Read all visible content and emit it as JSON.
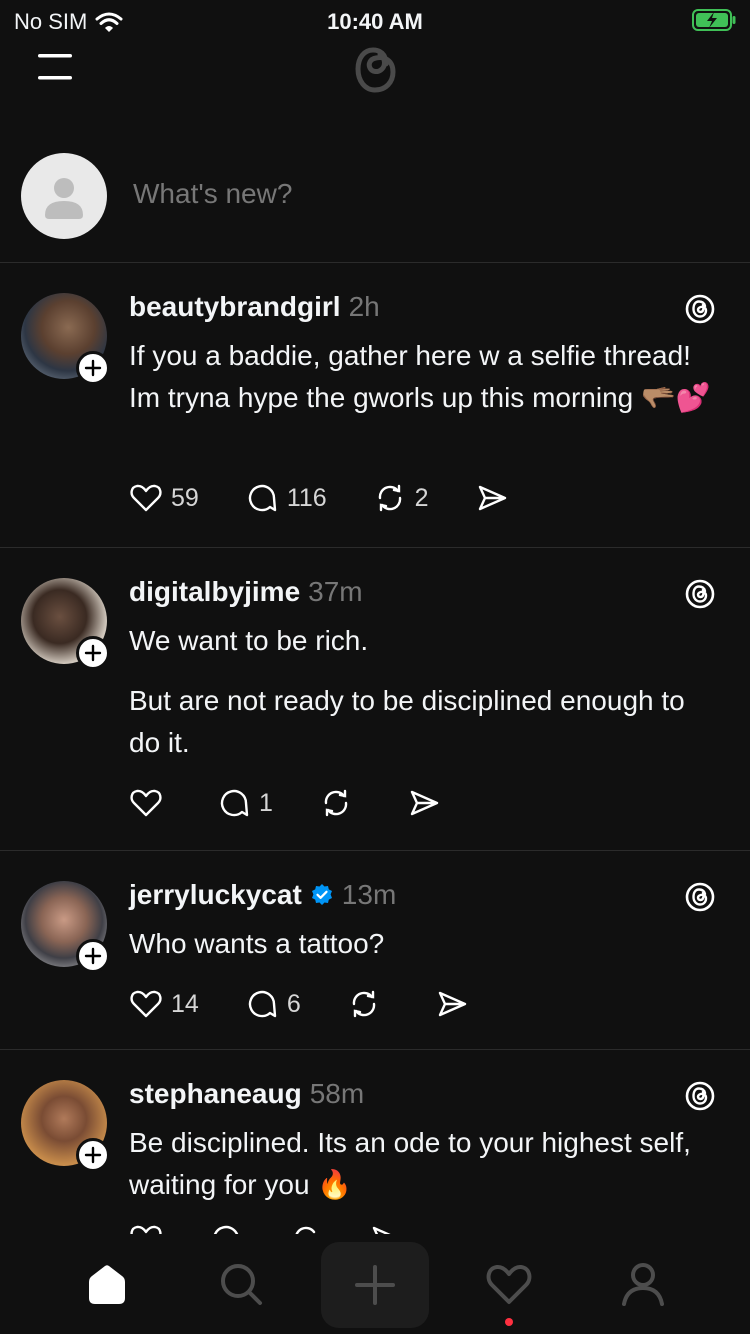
{
  "status_bar": {
    "carrier": "No SIM",
    "time": "10:40 AM",
    "battery_state": "charging",
    "icons": [
      "wifi-icon",
      "battery-charging-icon"
    ]
  },
  "header": {
    "icons": [
      "menu-icon",
      "threads-logo-icon"
    ]
  },
  "composer": {
    "placeholder": "What's new?"
  },
  "posts": [
    {
      "username": "beautybrandgirl",
      "time": "2h",
      "verified": false,
      "text": [
        "If you a baddie, gather here w a selfie thread! Im tryna hype the gworls up this morning 🫳🏽💕"
      ],
      "likes": "59",
      "replies": "116",
      "reposts": "2"
    },
    {
      "username": "digitalbyjime",
      "time": "37m",
      "verified": false,
      "text": [
        "We want to be rich.",
        "But are not ready to be disciplined enough to do it."
      ],
      "likes": "",
      "replies": "1",
      "reposts": ""
    },
    {
      "username": "jerryluckycat",
      "time": "13m",
      "verified": true,
      "text": [
        "Who wants a tattoo?"
      ],
      "likes": "14",
      "replies": "6",
      "reposts": ""
    },
    {
      "username": "stephaneaug",
      "time": "58m",
      "verified": false,
      "text": [
        "Be disciplined. Its an ode to your highest self, waiting for you 🔥"
      ],
      "likes": "",
      "replies": "",
      "reposts": ""
    }
  ],
  "bottom_nav": {
    "items": [
      "home-icon",
      "search-icon",
      "create-icon",
      "activity-icon",
      "profile-icon"
    ],
    "active": "home-icon",
    "activity_has_notification": true
  },
  "colors": {
    "background": "#101010",
    "text": "#f3f5f7",
    "muted": "#777777",
    "verified": "#0095f6",
    "notification": "#ff3040"
  }
}
